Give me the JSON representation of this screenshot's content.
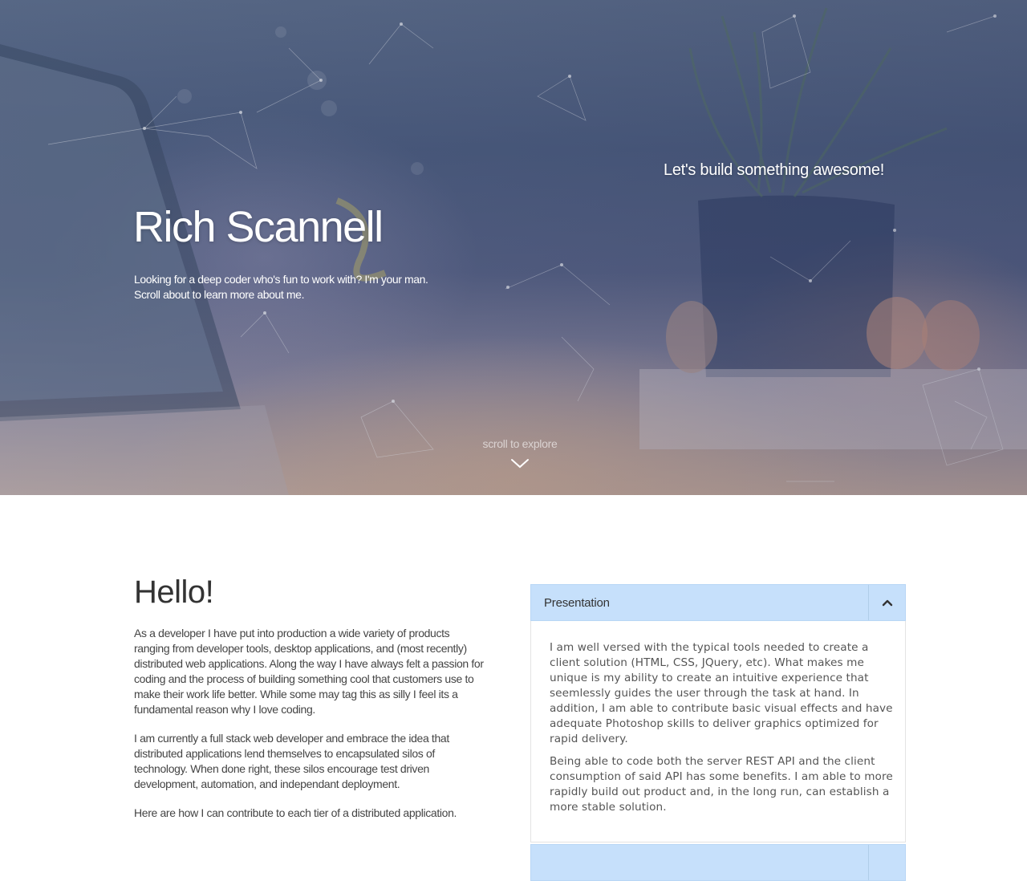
{
  "hero": {
    "tagline": "Let's build something awesome!",
    "name": "Rich Scannell",
    "subtitle_lines": [
      "Looking for a deep coder who's fun to work with? I'm your man.",
      "Scroll about to learn more about me."
    ],
    "scroll_label": "scroll to explore",
    "scroll_icon": "chevron-down-icon"
  },
  "about": {
    "heading": "Hello!",
    "paragraphs": [
      [
        "As a developer I have put into production a wide variety of products",
        "ranging from developer tools, desktop applications, and (most recently)",
        "distributed web applications. Along the way I have always felt a passion for",
        "coding and the process of building something cool that customers use to",
        "make their work life better. While some may tag this as silly I feel its a",
        "fundamental reason why I love coding."
      ],
      [
        "I am currently a full stack web developer and embrace the idea that",
        "distributed applications lend themselves to encapsulated silos of",
        "technology. When done right, these silos encourage test driven",
        "development, automation, and independant deployment."
      ],
      [
        "Here are how I can contribute to each tier of a distributed application."
      ]
    ]
  },
  "accordion": {
    "panels": [
      {
        "title": "Presentation",
        "toggle_icon": "chevron-up-icon",
        "expanded": true,
        "paragraphs": [
          [
            "I am well versed with the typical tools needed to create a",
            "client solution (HTML, CSS, JQuery, etc). What makes me",
            "unique is my ability to create an intuitive experience that",
            "seemlessly guides the user through the task at hand. In",
            "addition, I am able to contribute basic visual effects and have",
            "adequate Photoshop skills to deliver graphics optimized for",
            "rapid delivery."
          ],
          [
            "Being able to code both the server REST API and the client",
            "consumption of said API has some benefits. I am able to more",
            "rapidly build out product and, in the long run, can establish a",
            "more stable solution."
          ]
        ]
      }
    ]
  },
  "colors": {
    "accordion_header": "#c6e0fb",
    "hero_text": "#ffffff",
    "body_text": "#444444"
  }
}
